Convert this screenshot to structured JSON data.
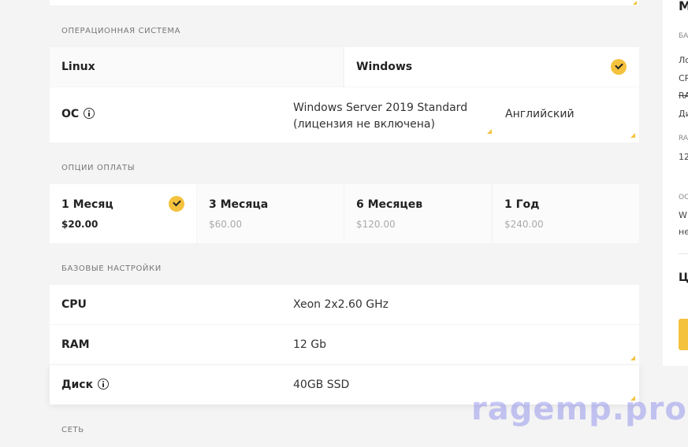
{
  "sections": {
    "os": "ОПЕРАЦИОННАЯ СИСТЕМА",
    "payment": "ОПЦИИ ОПЛАТЫ",
    "base": "БАЗОВЫЕ НАСТРОЙКИ",
    "network": "СЕТЬ"
  },
  "os_tabs": [
    {
      "label": "Linux",
      "selected": false
    },
    {
      "label": "Windows",
      "selected": true
    }
  ],
  "os_row": {
    "label": "ОС",
    "version_line1": "Windows Server 2019 Standard",
    "version_line2": "(лицензия не включена)",
    "language": "Английский"
  },
  "payment_options": [
    {
      "period": "1 Месяц",
      "price": "$20.00",
      "selected": true
    },
    {
      "period": "3 Месяца",
      "price": "$60.00",
      "selected": false
    },
    {
      "period": "6 Месяцев",
      "price": "$120.00",
      "selected": false
    },
    {
      "period": "1 Год",
      "price": "$240.00",
      "selected": false
    }
  ],
  "base_settings": {
    "cpu_label": "CPU",
    "cpu_value": "Xeon 2x2.60 GHz",
    "ram_label": "RAM",
    "ram_value": "12 Gb",
    "disk_label": "Диск",
    "disk_value": "40GB SSD"
  },
  "sidebar": {
    "title": "М",
    "base": "БА",
    "l1": "Ло",
    "l2": "CP",
    "l3": "RA",
    "l4": "Ди",
    "ram": "RA",
    "ram_val": "12",
    "os": "ОС",
    "os1": "W",
    "os2": "не",
    "price": "Ц"
  },
  "watermark": "ragemp.pro",
  "colors": {
    "accent": "#f4c23d",
    "background": "#f4f4f4"
  }
}
